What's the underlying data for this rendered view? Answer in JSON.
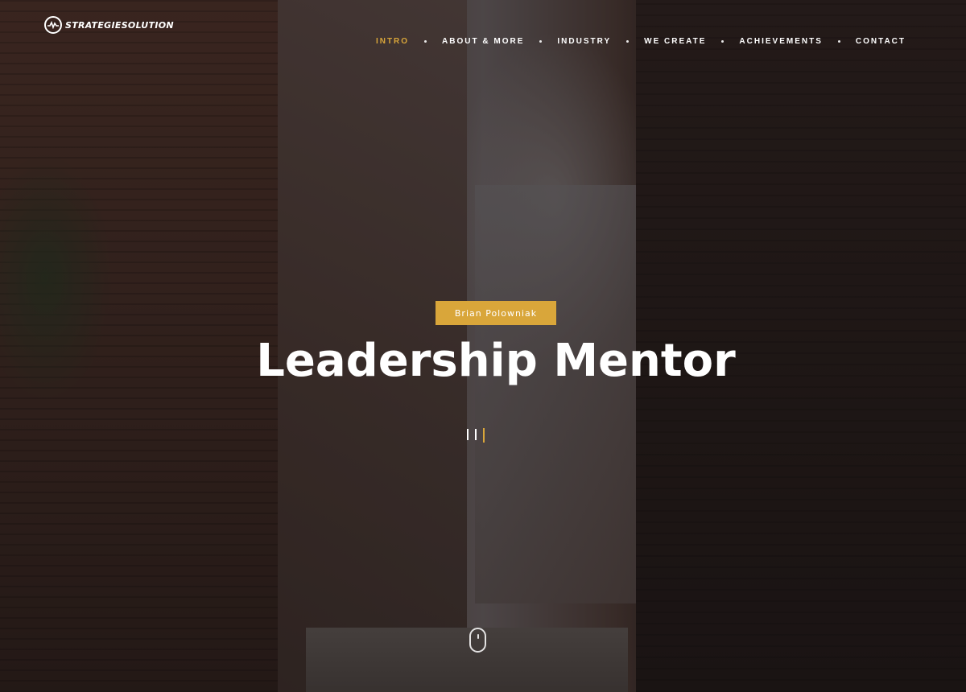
{
  "header": {
    "logo_text": "STRATEGIESOLUTION",
    "logo_icon": "pulse-circle-icon"
  },
  "nav": {
    "items": [
      {
        "label": "INTRO",
        "active": true
      },
      {
        "label": "ABOUT & MORE",
        "active": false
      },
      {
        "label": "INDUSTRY",
        "active": false
      },
      {
        "label": "WE CREATE",
        "active": false
      },
      {
        "label": "ACHIEVEMENTS",
        "active": false
      },
      {
        "label": "CONTACT",
        "active": false
      }
    ]
  },
  "hero": {
    "badge": "Brian Polowniak",
    "title": "Leadership Mentor",
    "scroll_icon": "mouse-scroll-icon"
  },
  "colors": {
    "accent": "#d9a63a",
    "text": "#ffffff"
  }
}
